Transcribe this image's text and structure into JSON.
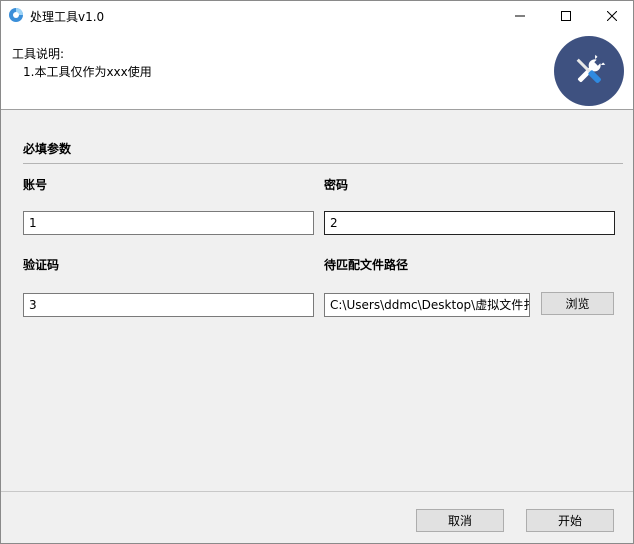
{
  "window": {
    "title": "处理工具v1.0",
    "controls": {
      "minimize": "minimize-icon",
      "maximize": "maximize-icon",
      "close": "close-icon"
    }
  },
  "header": {
    "description_title": "工具说明:",
    "description_lines": [
      "1.本工具仅作为xxx使用"
    ],
    "badge_icon": "tools-icon",
    "badge_color": "#3e5180"
  },
  "form": {
    "section_title": "必填参数",
    "account": {
      "label": "账号",
      "value": "1"
    },
    "password": {
      "label": "密码",
      "value": "2"
    },
    "captcha": {
      "label": "验证码",
      "value": "3"
    },
    "path": {
      "label": "待匹配文件路径",
      "value": "C:\\Users\\ddmc\\Desktop\\虚拟文件扌"
    },
    "browse_label": "浏览"
  },
  "footer": {
    "cancel_label": "取消",
    "start_label": "开始"
  }
}
